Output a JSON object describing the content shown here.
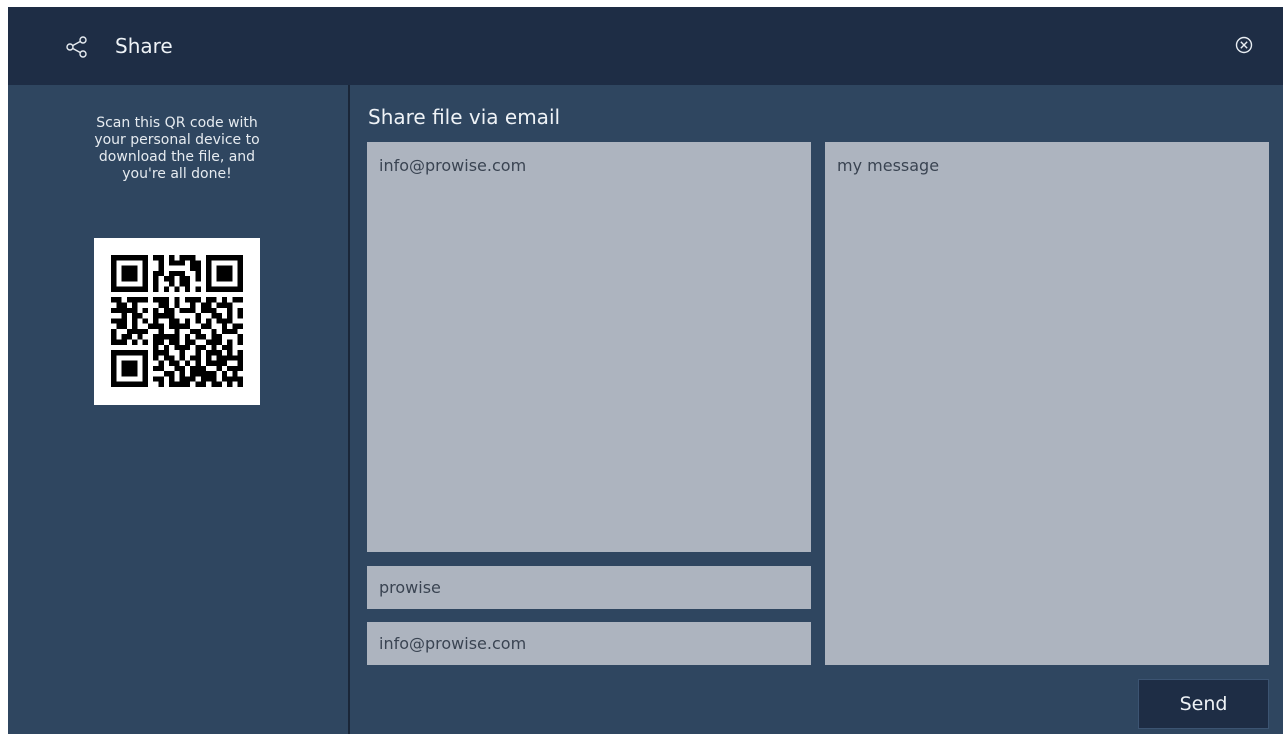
{
  "header": {
    "title": "Share",
    "icon": "share-icon",
    "close_icon": "close-circle-icon"
  },
  "sidebar": {
    "instructions": "Scan this QR code with your personal device to download the file, and you're all done!",
    "qr_icon": "qr-code-icon"
  },
  "email": {
    "section_title": "Share file via email",
    "to_value": "info@prowise.com",
    "name_value": "prowise",
    "from_value": "info@prowise.com",
    "message_value": "my message",
    "send_label": "Send"
  },
  "colors": {
    "panel": "#2f4660",
    "header": "#1e2d45",
    "field": "#adb4bf",
    "text_light": "#eef2f6",
    "text_dark": "#3a4452"
  }
}
